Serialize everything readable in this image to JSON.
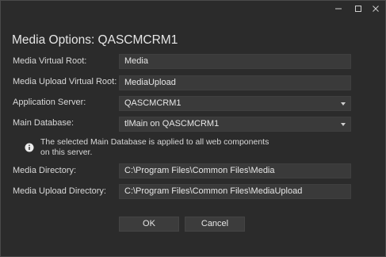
{
  "window": {
    "controls": {
      "minimize_icon": "minimize-icon",
      "maximize_icon": "maximize-icon",
      "close_icon": "close-icon"
    }
  },
  "dialog": {
    "title": "Media Options: QASCMCRM1"
  },
  "fields": [
    {
      "label": "Media Virtual Root:",
      "value": "Media",
      "type": "text"
    },
    {
      "label": "Media Upload Virtual Root:",
      "value": "MediaUpload",
      "type": "text"
    },
    {
      "label": "Application Server:",
      "value": "QASCMCRM1",
      "type": "select"
    },
    {
      "label": "Main Database:",
      "value": "tlMain on QASCMCRM1",
      "type": "select"
    },
    {
      "label": "Media Directory:",
      "value": "C:\\Program Files\\Common Files\\Media",
      "type": "text"
    },
    {
      "label": "Media Upload Directory:",
      "value": "C:\\Program Files\\Common Files\\MediaUpload",
      "type": "text"
    }
  ],
  "info": {
    "icon": "info-icon",
    "text": "The selected Main Database is applied to all web components on this server."
  },
  "buttons": {
    "ok_label": "OK",
    "cancel_label": "Cancel"
  },
  "colors": {
    "background": "#2b2b2b",
    "field": "#3a3a3a",
    "text": "#e6e6e6"
  }
}
